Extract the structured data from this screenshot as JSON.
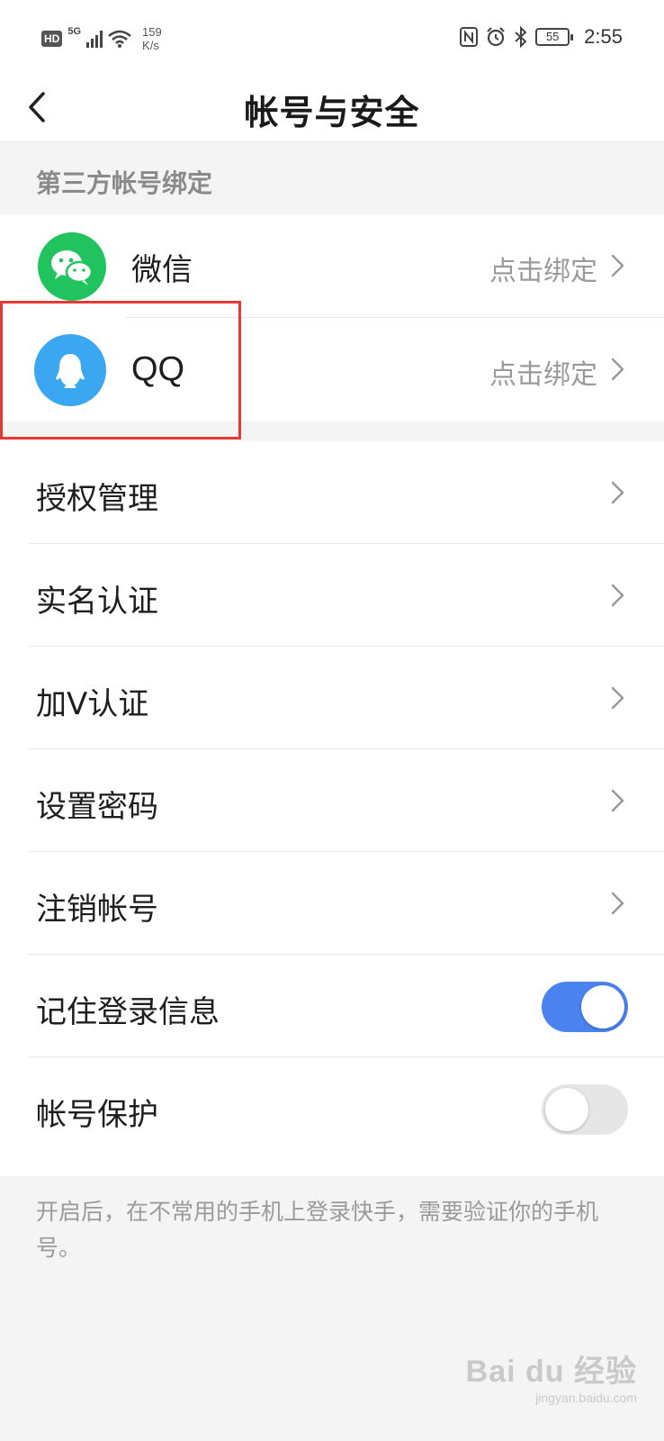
{
  "status_bar": {
    "hd": "HD",
    "network": "5G",
    "speed_value": "159",
    "speed_unit": "K/s",
    "battery": "55",
    "time": "2:55"
  },
  "header": {
    "title": "帐号与安全"
  },
  "third_party": {
    "section_title": "第三方帐号绑定",
    "items": [
      {
        "label": "微信",
        "action": "点击绑定",
        "icon": "wechat-icon",
        "color": "#21c35e"
      },
      {
        "label": "QQ",
        "action": "点击绑定",
        "icon": "qq-icon",
        "color": "#3aa7f0"
      }
    ]
  },
  "settings": {
    "items": [
      {
        "label": "授权管理"
      },
      {
        "label": "实名认证"
      },
      {
        "label": "加V认证"
      },
      {
        "label": "设置密码"
      },
      {
        "label": "注销帐号"
      },
      {
        "label": "记住登录信息",
        "toggle": true
      },
      {
        "label": "帐号保护",
        "toggle": false
      }
    ]
  },
  "footnote": "开启后，在不常用的手机上登录快手，需要验证你的手机号。",
  "watermark": {
    "main": "Bai du 经验",
    "sub": "jingyan.baidu.com"
  },
  "colors": {
    "toggle_on": "#4a82f0",
    "toggle_off": "#e6e6e6",
    "highlight": "#e53935"
  }
}
